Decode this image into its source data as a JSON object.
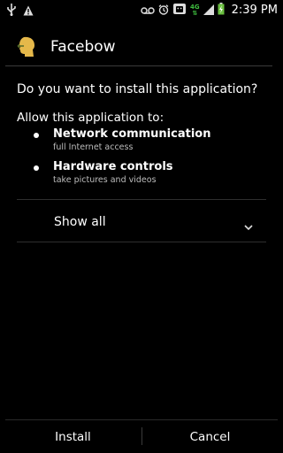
{
  "status_bar": {
    "time": "2:39 PM",
    "network": "4G",
    "icons": [
      "usb-icon",
      "warning-icon",
      "voicemail-icon",
      "alarm-icon",
      "android-icon",
      "signal-icon",
      "battery-charging-icon"
    ]
  },
  "dialog": {
    "app_name": "Facebow",
    "question": "Do you want to install this application?",
    "allow_heading": "Allow this application to:",
    "permissions": [
      {
        "title": "Network communication",
        "subtitle": "full Internet access"
      },
      {
        "title": "Hardware controls",
        "subtitle": "take pictures and videos"
      }
    ],
    "show_all_label": "Show all"
  },
  "buttons": {
    "install_label": "Install",
    "cancel_label": "Cancel"
  },
  "colors": {
    "background": "#000000",
    "network_green": "#3fbf3f",
    "subtitle_gray": "#bdbdbd"
  }
}
